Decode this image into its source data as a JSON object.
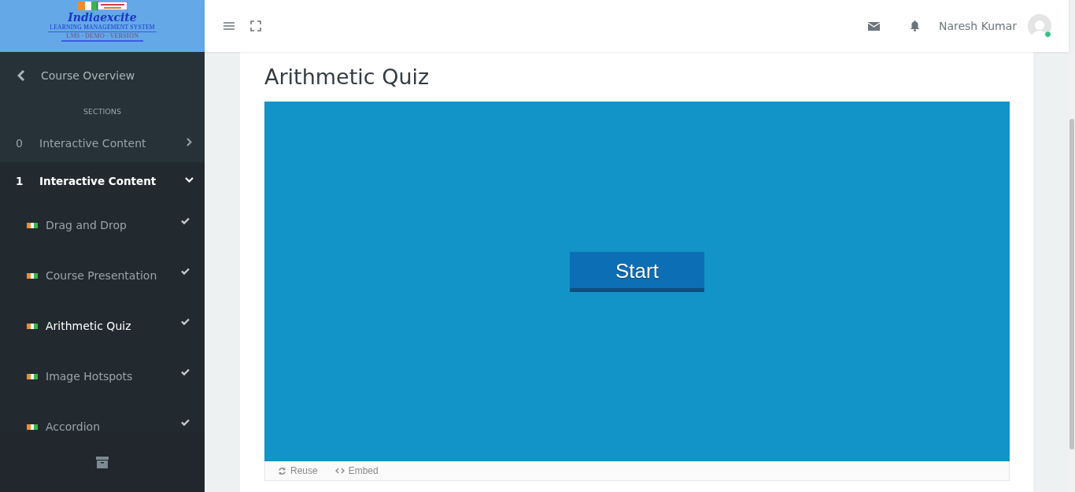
{
  "logo": {
    "brand": "Indiaexcite",
    "tagline": "LEARNING MANAGEMENT SYSTEM",
    "edition": "LMS - DEMO - VERSION"
  },
  "sidebar": {
    "back_link": "Course Overview",
    "heading": "SECTIONS",
    "sections": [
      {
        "number": "0",
        "title": "Interactive Content",
        "expanded": false
      },
      {
        "number": "1",
        "title": "Interactive Content",
        "expanded": true,
        "children": [
          {
            "title": "Drag and Drop",
            "completed": true,
            "selected": false
          },
          {
            "title": "Course Presentation",
            "completed": true,
            "selected": false
          },
          {
            "title": "Arithmetic Quiz",
            "completed": true,
            "selected": true
          },
          {
            "title": "Image Hotspots",
            "completed": true,
            "selected": false
          },
          {
            "title": "Accordion",
            "completed": true,
            "selected": false
          }
        ]
      }
    ]
  },
  "user": {
    "name": "Naresh Kumar",
    "online": true
  },
  "page": {
    "title": "Arithmetic Quiz",
    "start_button": "Start",
    "actions": [
      {
        "kind": "reuse",
        "label": "Reuse"
      },
      {
        "kind": "embed",
        "label": "Embed"
      }
    ]
  }
}
